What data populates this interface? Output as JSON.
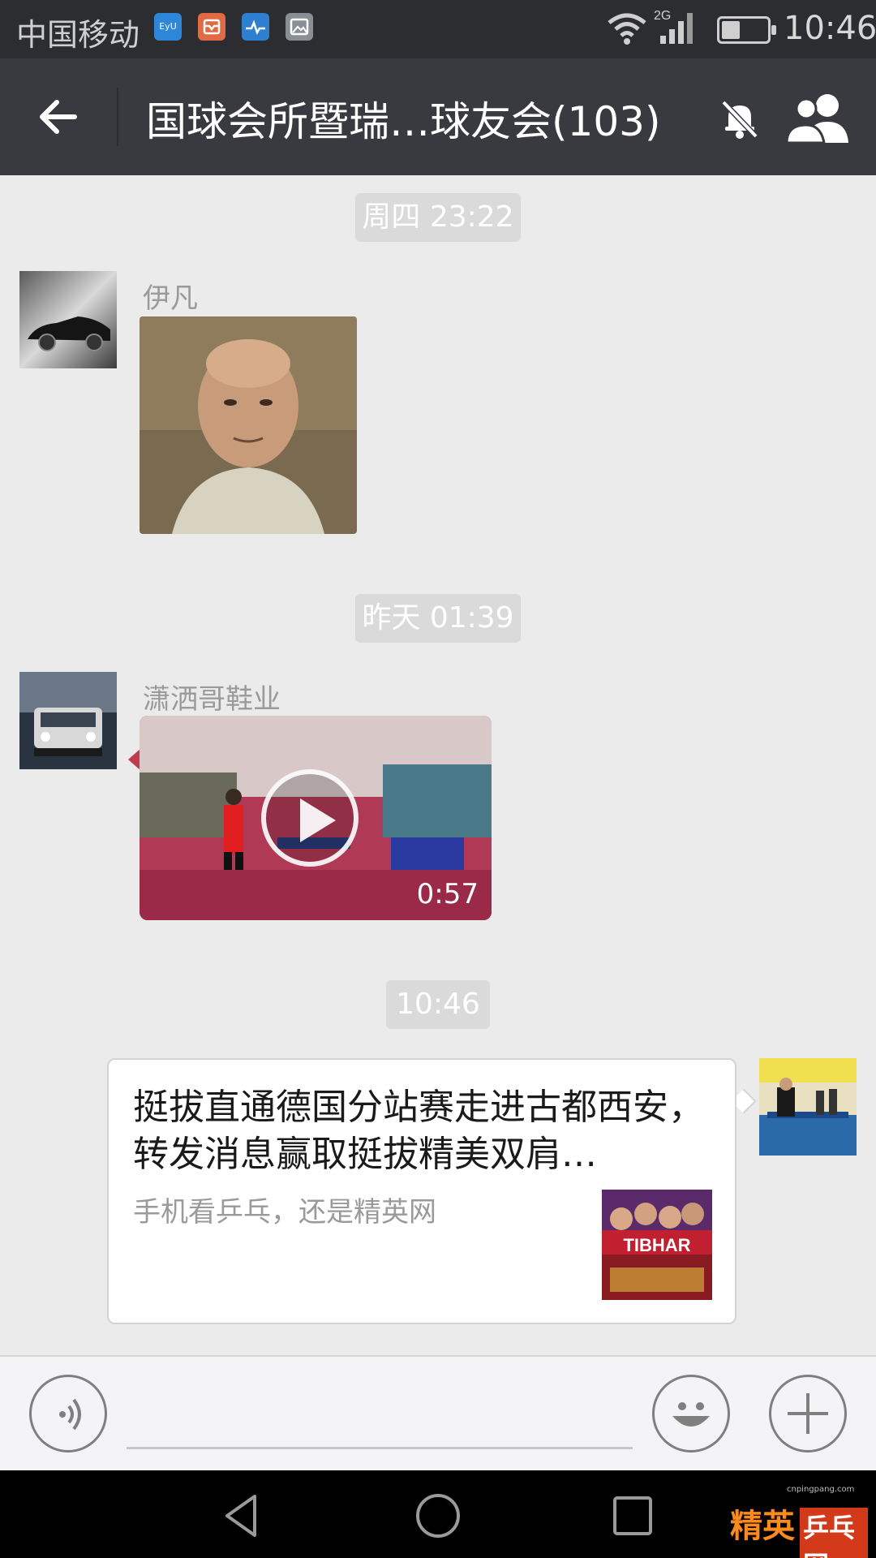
{
  "status_bar": {
    "carrier": "中国移动",
    "time": "10:46",
    "network": "2G",
    "notification_icons": [
      "app-icon",
      "mail-icon",
      "health-icon",
      "gallery-icon"
    ]
  },
  "header": {
    "title": "国球会所暨瑞…球友会(103)",
    "muted": true
  },
  "messages": [
    {
      "type": "time",
      "text": "周四 23:22"
    },
    {
      "type": "image",
      "sender": "伊凡",
      "avatar": "sports-car-avatar"
    },
    {
      "type": "time",
      "text": "昨天 01:39"
    },
    {
      "type": "video",
      "sender": "潇洒哥鞋业",
      "avatar": "suv-avatar",
      "duration": "0:57"
    },
    {
      "type": "time",
      "text": "10:46"
    },
    {
      "type": "link",
      "from_self": true,
      "title": "挺拔直通德国分站赛走进古都西安，转发消息赢取挺拔精美双肩…",
      "description": "手机看乒乓，还是精英网",
      "thumbnail_text": "TIBHAR"
    }
  ],
  "input_bar": {
    "placeholder": ""
  },
  "watermark": {
    "brand_a": "精英",
    "brand_b": "乒乓网",
    "url": "cnpingpang.com"
  },
  "colors": {
    "status_bar_bg": "#2c2d31",
    "title_bar_bg": "#393a3f",
    "chat_bg": "#ebebeb",
    "time_pill_bg": "#dadada"
  }
}
